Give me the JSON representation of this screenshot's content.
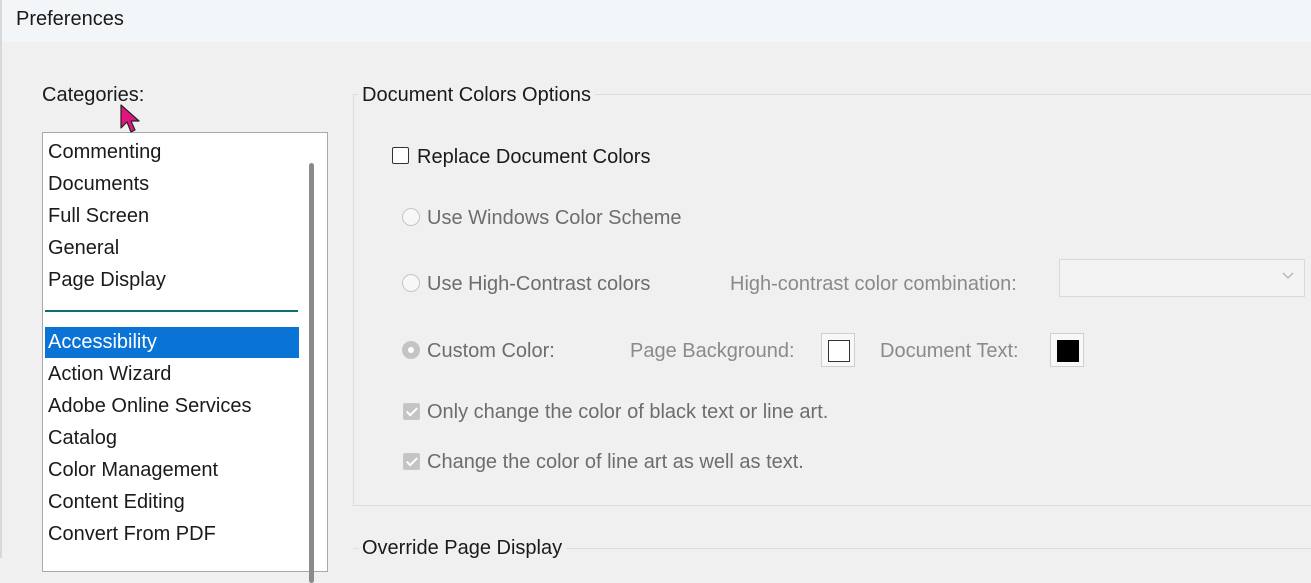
{
  "window": {
    "title": "Preferences"
  },
  "categories": {
    "label": "Categories:",
    "top_items": [
      "Commenting",
      "Documents",
      "Full Screen",
      "General",
      "Page Display"
    ],
    "items": [
      "Accessibility",
      "Action Wizard",
      "Adobe Online Services",
      "Catalog",
      "Color Management",
      "Content Editing",
      "Convert From PDF"
    ],
    "selected": "Accessibility"
  },
  "document_colors": {
    "title": "Document Colors Options",
    "replace_label": "Replace Document Colors",
    "replace_checked": false,
    "windows_scheme_label": "Use Windows Color Scheme",
    "high_contrast_label": "Use High-Contrast colors",
    "high_contrast_combo_label": "High-contrast color combination:",
    "high_contrast_combo_value": "",
    "custom_color_label": "Custom Color:",
    "custom_color_selected": true,
    "page_background_label": "Page Background:",
    "page_background_color": "#ffffff",
    "document_text_label": "Document Text:",
    "document_text_color": "#000000",
    "only_black_label": "Only change the color of black text or line art.",
    "only_black_checked": true,
    "line_art_label": "Change the color of line art as well as text.",
    "line_art_checked": true
  },
  "override_page_display": {
    "title": "Override Page Display"
  },
  "colors": {
    "selection": "#0a74d6",
    "separator": "#0d6f74",
    "cursor": "#e0157f"
  }
}
